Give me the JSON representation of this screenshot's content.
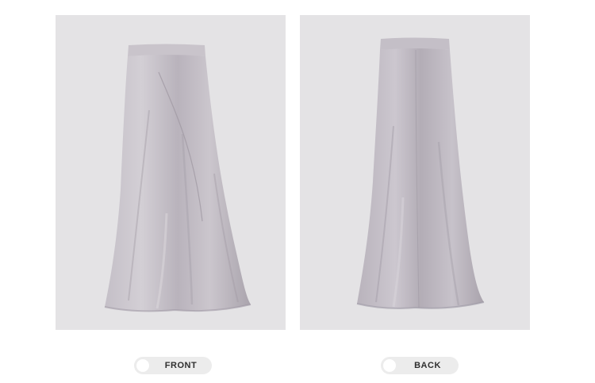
{
  "views": [
    {
      "label": "FRONT",
      "photo": "skirt-front-image",
      "background": "#e4e3e5",
      "garment_color": "#b8b2bb"
    },
    {
      "label": "BACK",
      "photo": "skirt-back-image",
      "background": "#e4e3e5",
      "garment_color": "#b5afb8"
    }
  ],
  "toggle": {
    "pill_color": "#ececec",
    "dot_color": "#ffffff",
    "text_color": "#2f2f2f"
  }
}
